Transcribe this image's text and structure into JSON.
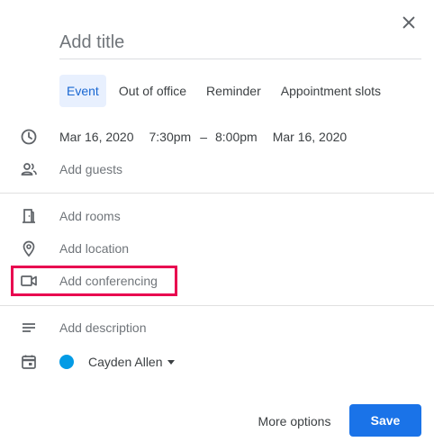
{
  "dialog": {
    "title_placeholder": "Add title",
    "close_icon": "close-icon"
  },
  "tabs": [
    {
      "label": "Event",
      "active": true
    },
    {
      "label": "Out of office",
      "active": false
    },
    {
      "label": "Reminder",
      "active": false
    },
    {
      "label": "Appointment slots",
      "active": false
    }
  ],
  "datetime": {
    "start_date": "Mar 16, 2020",
    "start_time": "7:30pm",
    "separator": "–",
    "end_time": "8:00pm",
    "end_date": "Mar 16, 2020"
  },
  "fields": {
    "guests": "Add guests",
    "rooms": "Add rooms",
    "location": "Add location",
    "conferencing": "Add conferencing",
    "description": "Add description"
  },
  "calendar": {
    "owner": "Cayden Allen",
    "color": "#039be5"
  },
  "actions": {
    "more_options": "More options",
    "save": "Save"
  },
  "colors": {
    "accent": "#1a73e8",
    "active_tab_bg": "#e8f0fe",
    "highlight": "#e8004f"
  }
}
